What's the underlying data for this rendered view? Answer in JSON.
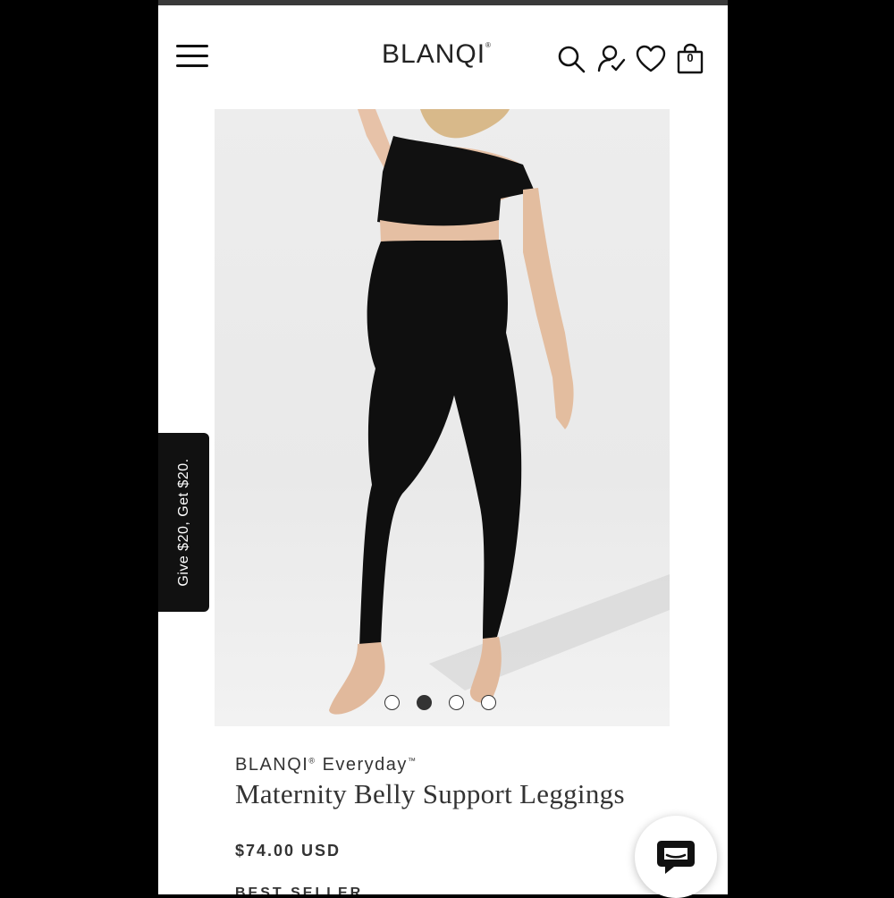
{
  "header": {
    "logo": "BLANQI",
    "logo_mark": "®",
    "cart_count": "0",
    "icons": [
      "menu-icon",
      "search-icon",
      "account-icon",
      "wishlist-heart-icon",
      "cart-bag-icon"
    ]
  },
  "gallery": {
    "slide_count": 4,
    "active_slide": 2
  },
  "referral_tab": {
    "label": "Give $20, Get $20."
  },
  "product": {
    "brand": "BLANQI",
    "brand_mark": "®",
    "collection": "Everyday",
    "collection_mark": "™",
    "title": "Maternity Belly Support Leggings",
    "price": "$74.00 USD",
    "badge": "BEST SELLER"
  },
  "chat": {
    "icon": "chat-bubble-icon"
  },
  "colors": {
    "accent": "#111111",
    "text": "#333333",
    "image_bg": "#ececec"
  }
}
